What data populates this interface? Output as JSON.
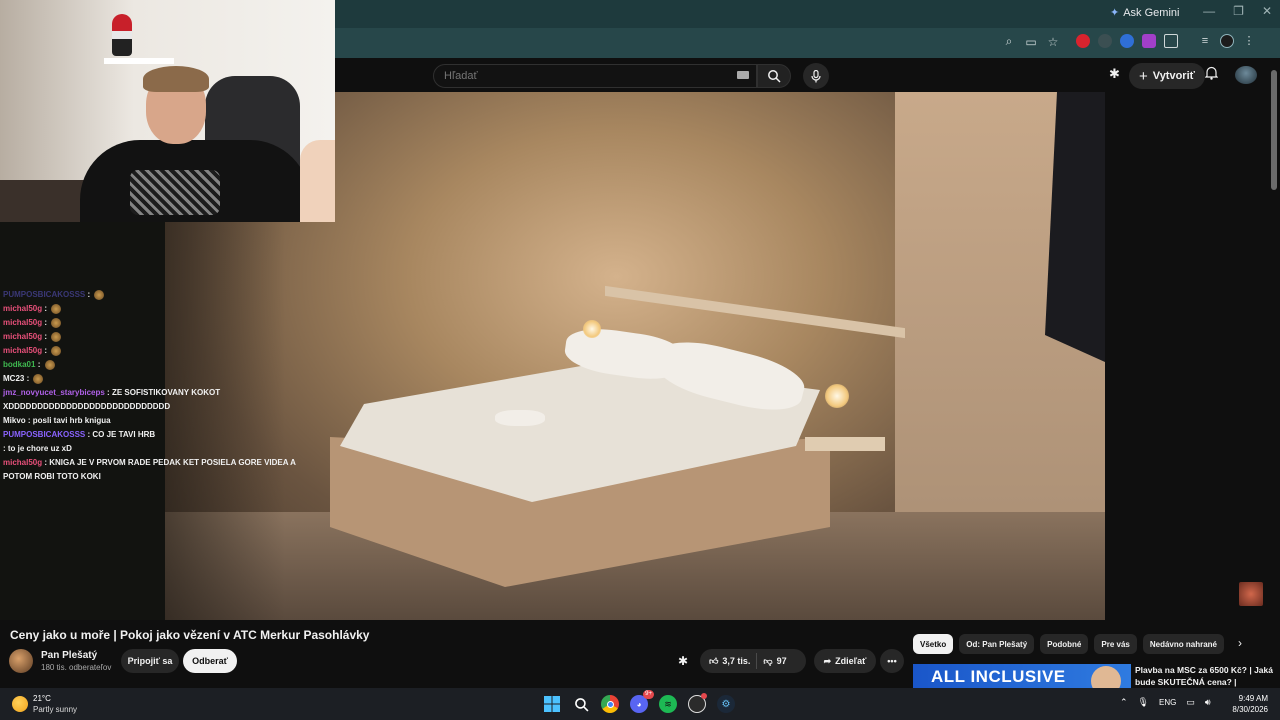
{
  "browser": {
    "ask_gemini_label": "Ask Gemini",
    "window_controls": [
      "—",
      "❐",
      "✕"
    ]
  },
  "youtube_header": {
    "search_placeholder": "Hľadať",
    "create_label": "Vytvoriť"
  },
  "chat": [
    {
      "user": "PUMPOSBICAKOSSS",
      "text": "",
      "color": "#5b56c9",
      "dim": true
    },
    {
      "user": "michal50g",
      "text": "",
      "color": "#e8507a"
    },
    {
      "user": "michal50g",
      "text": "",
      "color": "#e8507a"
    },
    {
      "user": "michal50g",
      "text": "",
      "color": "#e8507a"
    },
    {
      "user": "michal50g",
      "text": "",
      "color": "#e8507a"
    },
    {
      "user": "bodka01",
      "text": "",
      "color": "#3fb950"
    },
    {
      "user": "MC23",
      "text": "",
      "color": "#f1f1f1"
    },
    {
      "user": "jmz_novyucet_starybiceps",
      "text": "ZE SOFISTIKOVANY KOKOT XDDDDDDDDDDDDDDDDDDDDDDDDDDDD",
      "color": "#b061e8"
    },
    {
      "user": "Mikvo",
      "text": "posli tavi hrb knigua",
      "color": "#f1f1f1"
    },
    {
      "user": "PUMPOSBICAKOSSS",
      "text": "CO JE TAVI HRB",
      "color": "#8a63ff"
    },
    {
      "user": "",
      "text": "to je chore uz xD",
      "color": "#b3243a"
    },
    {
      "user": "michal50g",
      "text": "KNIGA JE V PRVOM RADE PEDAK KET POSIELA GORE VIDEA A POTOM ROBI TOTO KOKI",
      "color": "#e8507a"
    }
  ],
  "video": {
    "title": "Ceny jako u moře | Pokoj jako vězení v ATC Merkur Pasohlávky",
    "channel_name": "Pan Plešatý",
    "subscribers": "180 tis. odberateľov",
    "join_label": "Pripojiť sa",
    "subscribe_label": "Odberať",
    "likes": "3,7 tis.",
    "dislikes": "97",
    "share_label": "Zdieľať"
  },
  "chips": [
    "Všetko",
    "Od: Pan Plešatý",
    "Podobné",
    "Pre vás",
    "Nedávno nahrané"
  ],
  "recommendation": {
    "thumb_text": "ALL INCLUSIVE",
    "title": "Plavba na MSC za 6500 Kč? | Jaká bude SKUTEČNÁ cena? |"
  },
  "taskbar": {
    "temperature": "21°C",
    "weather": "Partly sunny",
    "language": "ENG",
    "time": "9:49 AM",
    "date": "8/30/2026",
    "discord_badge": "9+"
  }
}
